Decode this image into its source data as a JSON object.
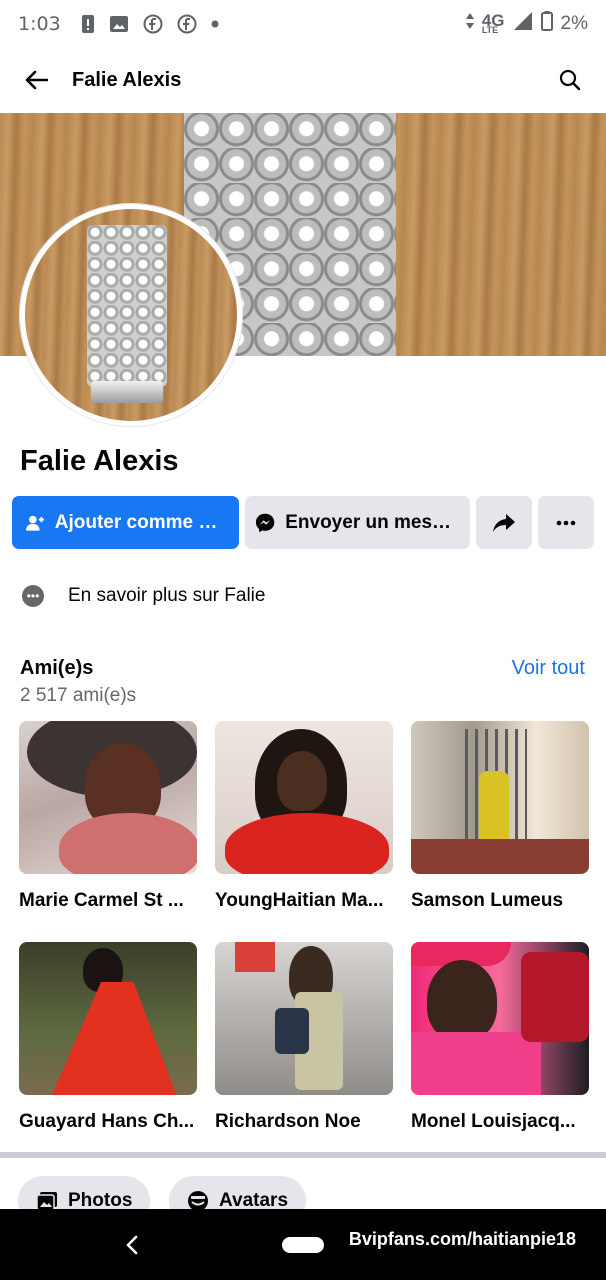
{
  "status_bar": {
    "time": "1:03",
    "network": "4G",
    "network_sub": "LTE",
    "battery": "2%"
  },
  "app_bar": {
    "title": "Falie Alexis"
  },
  "profile": {
    "name": "Falie Alexis"
  },
  "actions": {
    "add_friend": "Ajouter comme ami(e)",
    "message": "Envoyer un message"
  },
  "about": {
    "label": "En savoir plus sur Falie"
  },
  "friends": {
    "title": "Ami(e)s",
    "count": "2 517 ami(e)s",
    "see_all": "Voir tout",
    "items": [
      {
        "name": "Marie Carmel St ..."
      },
      {
        "name": "YoungHaitian Ma..."
      },
      {
        "name": "Samson Lumeus"
      },
      {
        "name": "Guayard Hans Ch..."
      },
      {
        "name": "Richardson Noe"
      },
      {
        "name": "Monel Louisjacq..."
      }
    ]
  },
  "chips": {
    "photos": "Photos",
    "avatars": "Avatars"
  },
  "watermark": "Bvipfans.com/haitianpie18",
  "colors": {
    "primary": "#1877f2",
    "secondary_bg": "#e4e6eb",
    "link": "#1b74e4",
    "muted": "#65676b"
  },
  "icons": [
    "back-arrow-icon",
    "search-icon",
    "add-friend-icon",
    "messenger-icon",
    "share-icon",
    "more-icon",
    "info-icon",
    "photos-icon",
    "avatars-icon"
  ]
}
